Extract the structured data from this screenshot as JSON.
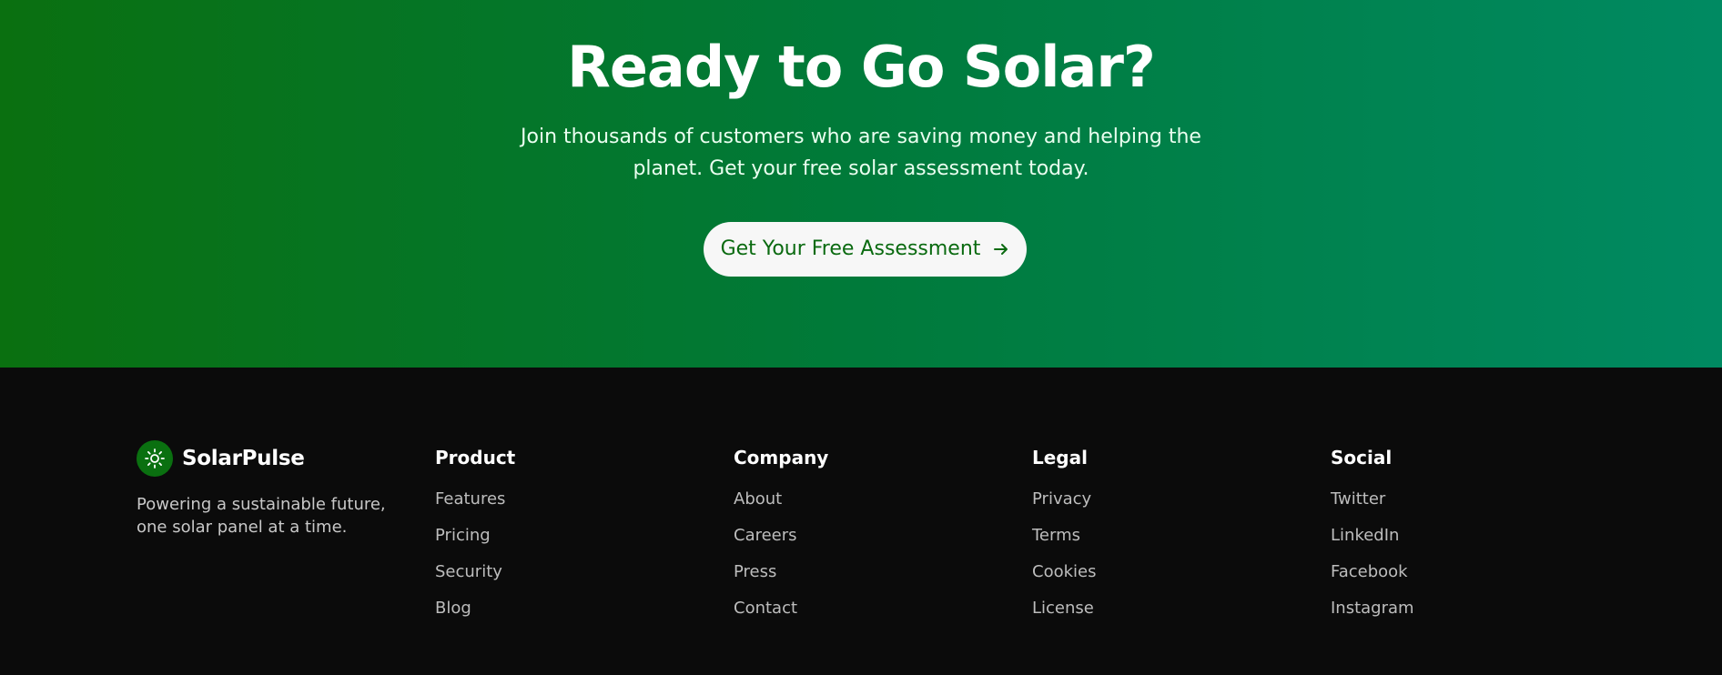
{
  "cta": {
    "title": "Ready to Go Solar?",
    "subtitle": "Join thousands of customers who are saving money and helping the planet. Get your free solar assessment today.",
    "button_label": "Get Your Free Assessment",
    "button_icon": "arrow-right-icon"
  },
  "footer": {
    "brand": {
      "name": "SolarPulse",
      "logo_icon": "sun-icon",
      "tagline": "Powering a sustainable future, one solar panel at a time."
    },
    "columns": [
      {
        "title": "Product",
        "links": [
          "Features",
          "Pricing",
          "Security",
          "Blog"
        ]
      },
      {
        "title": "Company",
        "links": [
          "About",
          "Careers",
          "Press",
          "Contact"
        ]
      },
      {
        "title": "Legal",
        "links": [
          "Privacy",
          "Terms",
          "Cookies",
          "License"
        ]
      },
      {
        "title": "Social",
        "links": [
          "Twitter",
          "LinkedIn",
          "Facebook",
          "Instagram"
        ]
      }
    ]
  },
  "colors": {
    "gradient_start": "#0a7010",
    "gradient_end": "#008a62",
    "footer_bg": "#0b0b0b",
    "button_text": "#0a6a10"
  }
}
